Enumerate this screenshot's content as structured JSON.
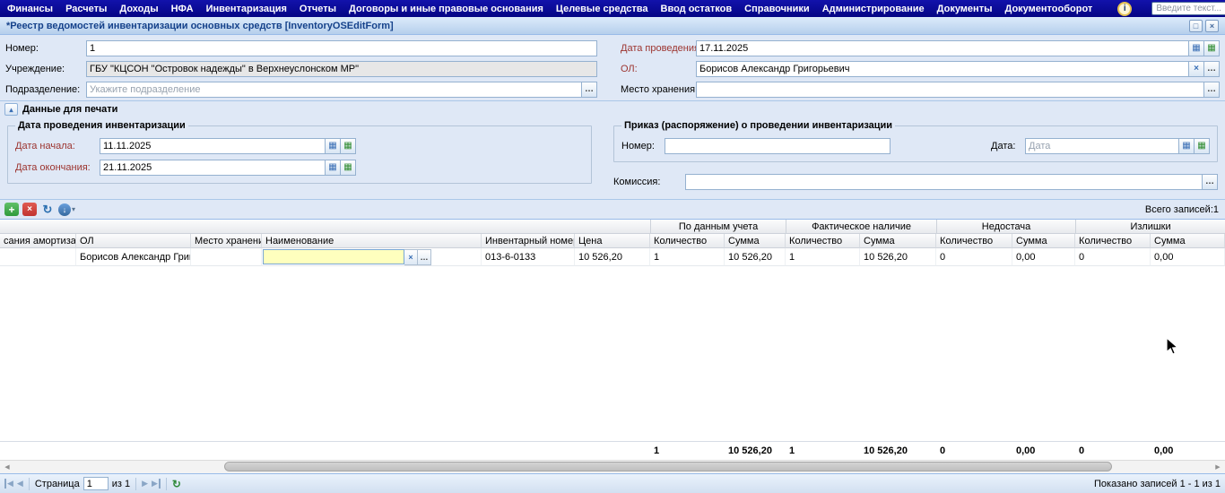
{
  "menu": {
    "items": [
      "Финансы",
      "Расчеты",
      "Доходы",
      "НФА",
      "Инвентаризация",
      "Отчеты",
      "Договоры и иные правовые основания",
      "Целевые средства",
      "Ввод остатков",
      "Справочники",
      "Администрирование",
      "Документы",
      "Документооборот"
    ],
    "search": {
      "placeholder": "Введите текст..."
    }
  },
  "window": {
    "title": "*Реестр ведомостей инвентаризации основных средств [InventoryOSEditForm]"
  },
  "form": {
    "number_label": "Номер:",
    "number_value": "1",
    "date_label": "Дата проведения:",
    "date_value": "17.11.2025",
    "institution_label": "Учреждение:",
    "institution_value": "ГБУ \"КЦСОН \"Островок надежды\" в Верхнеуслонском МР\"",
    "ol_label": "ОЛ:",
    "ol_value": "Борисов Александр Григорьевич",
    "department_label": "Подразделение:",
    "department_placeholder": "Укажите подразделение",
    "storage_label": "Место хранения:",
    "storage_value": ""
  },
  "print_panel": {
    "title": "Данные для печати",
    "dates_legend": "Дата проведения инвентаризации",
    "start_label": "Дата начала:",
    "start_value": "11.11.2025",
    "end_label": "Дата окончания:",
    "end_value": "21.11.2025",
    "order_legend": "Приказ (распоряжение) о проведении инвентаризации",
    "order_number_label": "Номер:",
    "order_number_value": "",
    "order_date_label": "Дата:",
    "order_date_placeholder": "Дата",
    "commission_label": "Комиссия:",
    "commission_value": ""
  },
  "toolbar": {
    "total": "Всего записей:1"
  },
  "grid": {
    "groups": [
      "По данным учета",
      "Фактическое наличие",
      "Недостача",
      "Излишки"
    ],
    "columns": [
      "сания амортизации",
      "ОЛ",
      "Место хранения",
      "Наименование",
      "Инвентарный номер",
      "Цена",
      "Количество",
      "Сумма",
      "Количество",
      "Сумма",
      "Количество",
      "Сумма",
      "Количество",
      "Сумма"
    ],
    "row": {
      "ol": "Борисов Александр Григо...",
      "name_editor_value": "",
      "inv_number": "013-6-0133",
      "price": "10 526,20",
      "acc_qty": "1",
      "acc_sum": "10 526,20",
      "fact_qty": "1",
      "fact_sum": "10 526,20",
      "short_qty": "0",
      "short_sum": "0,00",
      "surplus_qty": "0",
      "surplus_sum": "0,00"
    },
    "summary": {
      "acc_qty": "1",
      "acc_sum": "10 526,20",
      "fact_qty": "1",
      "fact_sum": "10 526,20",
      "short_qty": "0",
      "short_sum": "0,00",
      "surplus_qty": "0",
      "surplus_sum": "0,00"
    }
  },
  "pager": {
    "page_label": "Страница",
    "page_value": "1",
    "of_label": "из 1",
    "status": "Показано записей 1 - 1 из 1"
  },
  "icons": {
    "info": "i",
    "window_restore": "□",
    "window_close": "×",
    "collapse": "▴",
    "calendar": "▦",
    "ellipsis": "…",
    "clear": "×",
    "add": "+",
    "delete": "×",
    "refresh": "↻",
    "export": "↓",
    "caret_down": "▾",
    "scroll_left": "◀",
    "scroll_right": "▶",
    "page_first": "◀",
    "page_prev": "◀",
    "page_next": "▶",
    "page_last": "▶"
  }
}
